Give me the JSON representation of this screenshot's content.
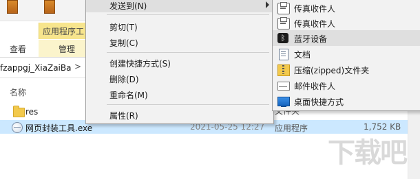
{
  "explorer": {
    "ribbon": {
      "context_tab": "应用程序工",
      "tabs": [
        "查看",
        "管理"
      ]
    },
    "address": {
      "path": "fzappgj_XiaZaiBa",
      "chevron": ">"
    },
    "columns": {
      "name": "名称"
    },
    "files": [
      {
        "name": "res",
        "date": "",
        "type": "文件夹",
        "size": "",
        "icon": "folder-icon"
      },
      {
        "name": "网页封装工具.exe",
        "date": "2021-05-25 12:27",
        "type": "应用程序",
        "size": "1,752 KB",
        "icon": "app-icon",
        "selected": true
      }
    ],
    "partial_type_label": "文件夹"
  },
  "context_menu": {
    "items": [
      {
        "label": "发送到(N)",
        "has_submenu": true,
        "highlighted": true
      },
      {
        "label": "剪切(T)"
      },
      {
        "label": "复制(C)"
      },
      {
        "label": "创建快捷方式(S)"
      },
      {
        "label": "删除(D)"
      },
      {
        "label": "重命名(M)"
      },
      {
        "label": "属性(R)"
      }
    ]
  },
  "send_to_menu": {
    "items": [
      {
        "label": "传真收件人",
        "icon": "fax-icon"
      },
      {
        "label": "传真收件人",
        "icon": "fax-icon"
      },
      {
        "label": "蓝牙设备",
        "icon": "bluetooth-icon",
        "highlighted": true
      },
      {
        "label": "文档",
        "icon": "document-icon"
      },
      {
        "label": "压缩(zipped)文件夹",
        "icon": "zip-folder-icon"
      },
      {
        "label": "邮件收件人",
        "icon": "mail-icon"
      },
      {
        "label": "桌面快捷方式",
        "icon": "desktop-icon"
      }
    ]
  },
  "watermark": {
    "text": "下载吧"
  },
  "colors": {
    "selection": "#cce8ff",
    "menu_bg": "#f2f2f2",
    "menu_highlight": "#dfdfdf",
    "context_tab": "#f7e58d"
  }
}
